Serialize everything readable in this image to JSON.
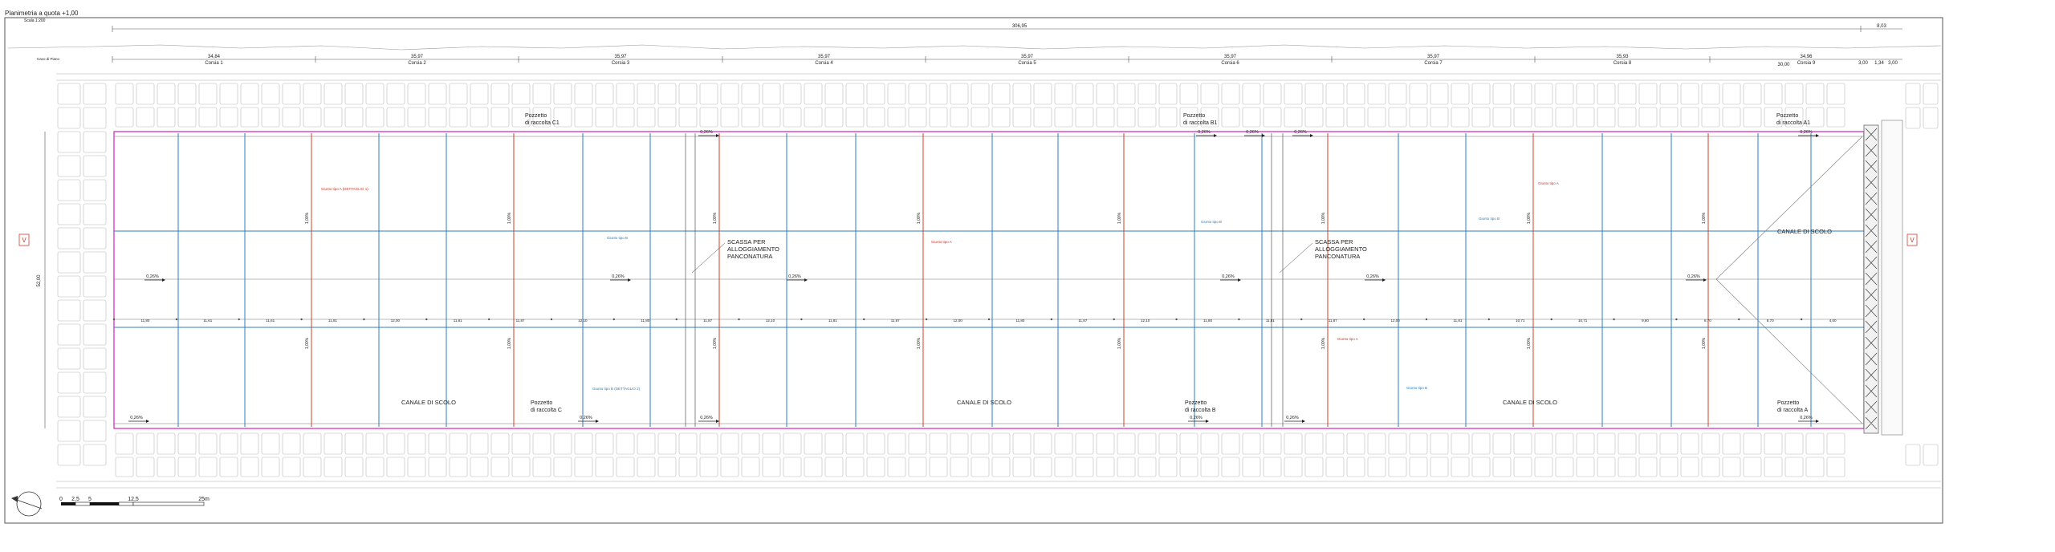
{
  "title": "Planimetria a quota +1,00",
  "scale_label": "Scala 1:200",
  "dims_top": {
    "total": "306,95",
    "extra": "8,03"
  },
  "dims_bays": [
    "34,84",
    "35,97",
    "35,97",
    "35,97",
    "35,97",
    "35,97",
    "35,97",
    "35,93",
    "34,96"
  ],
  "bay_labels": [
    "Corsia 1",
    "Corsia 2",
    "Corsia 3",
    "Corsia 4",
    "Corsia 5",
    "Corsia 6",
    "Corsia 7",
    "Corsia 8",
    "Corsia 9"
  ],
  "dims_right": [
    "30,00",
    "3,00",
    "1,34",
    "3,00"
  ],
  "left_small_label": "Cavo di Piano",
  "height_dim": "52,00",
  "slope_label": "0,26%",
  "slope_vertical": "1,00%",
  "pozzetti": [
    {
      "line1": "Pozzetto",
      "line2": "di raccolta C1"
    },
    {
      "line1": "Pozzetto",
      "line2": "di raccolta B1"
    },
    {
      "line1": "Pozzetto",
      "line2": "di raccolta A1"
    },
    {
      "line1": "Pozzetto",
      "line2": "di raccolta C"
    },
    {
      "line1": "Pozzetto",
      "line2": "di raccolta B"
    },
    {
      "line1": "Pozzetto",
      "line2": "di raccolta A"
    }
  ],
  "scassa": {
    "line1": "SCASSA PER",
    "line2": "ALLOGGIAMENTO",
    "line3": "PANCONATURA"
  },
  "canale": "CANALE DI SCOLO",
  "notes": {
    "red_a": "Giunto tipo A (DETTAGLIO 1)",
    "red_b": "Giunto tipo A",
    "blue_a": "Giunto tipo B",
    "blue_b": "Giunto tipo B (DETTAGLIO 2)"
  },
  "mid_dims": [
    "11,80",
    "11,61",
    "11,61",
    "11,81",
    "12,00",
    "11,81",
    "11,87",
    "12,10",
    "11,80",
    "11,87",
    "12,10",
    "11,81",
    "11,87",
    "12,00",
    "11,80",
    "11,87",
    "12,10",
    "11,80",
    "11,81",
    "11,87",
    "12,00",
    "11,81",
    "10,71",
    "10,71",
    "9,80",
    "8,70",
    "8,70",
    "4,00"
  ],
  "side_marker": "V",
  "scale_bar": {
    "ticks": [
      "0",
      "2,5",
      "5",
      "12,5",
      "25m"
    ]
  },
  "colors": {
    "red": "#d0402a",
    "blue": "#2a7fc1",
    "magenta": "#d020c0",
    "grid": "#b8b8b8",
    "line": "#444444"
  }
}
